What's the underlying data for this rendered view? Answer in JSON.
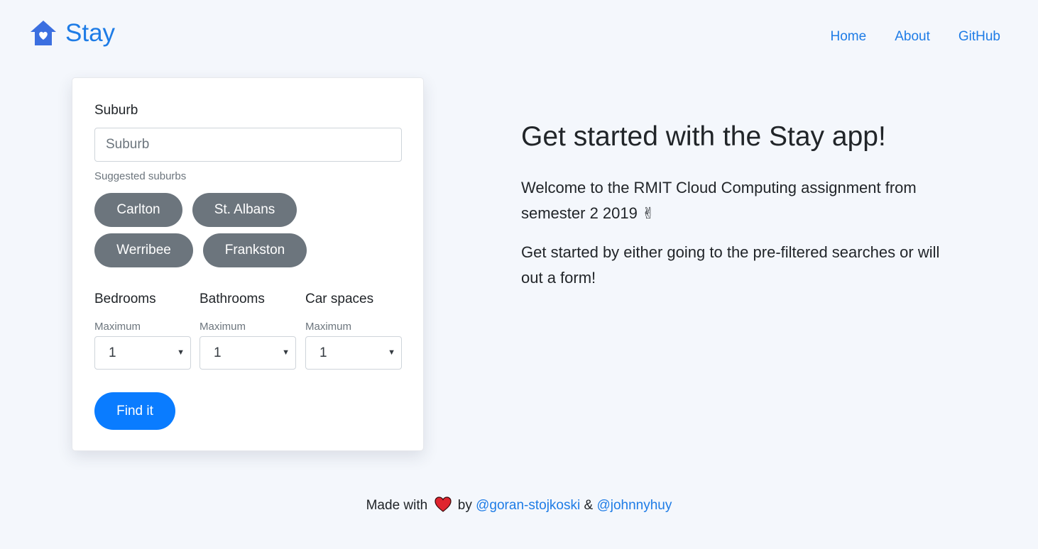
{
  "brand": {
    "name": "Stay",
    "icon": "house-heart-icon",
    "color": "#1e7ce6"
  },
  "nav": {
    "home": "Home",
    "about": "About",
    "github": "GitHub"
  },
  "form": {
    "suburb_label": "Suburb",
    "suburb_placeholder": "Suburb",
    "suburb_value": "",
    "suggested_label": "Suggested suburbs",
    "suggested": [
      "Carlton",
      "St. Albans",
      "Werribee",
      "Frankston"
    ],
    "bedrooms": {
      "label": "Bedrooms",
      "sub": "Maximum",
      "value": "1"
    },
    "bathrooms": {
      "label": "Bathrooms",
      "sub": "Maximum",
      "value": "1"
    },
    "car_spaces": {
      "label": "Car spaces",
      "sub": "Maximum",
      "value": "1"
    },
    "submit": "Find it"
  },
  "hero": {
    "title": "Get started with the Stay app!",
    "p1": "Welcome to the RMIT Cloud Computing assignment from semester 2 2019",
    "p1_emoji": "✌",
    "p2": "Get started by either going to the pre-filtered searches or will out a form!"
  },
  "footer": {
    "made_with": "Made with",
    "heart_icon": "heart-icon",
    "by": "by",
    "author1": "@goran-stojkoski",
    "amp": "&",
    "author2": "@johnnyhuy"
  },
  "colors": {
    "background": "#f4f7fc",
    "accent": "#1e7ce6",
    "primary_button": "#0a7cff",
    "chip": "#6c757d",
    "heart": "#e0242e"
  }
}
